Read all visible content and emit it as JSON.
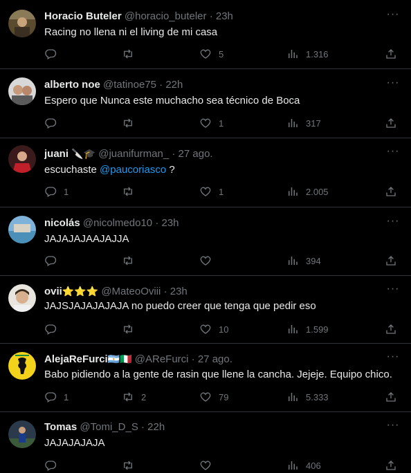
{
  "tweets": [
    {
      "name": "Horacio Buteler",
      "badges": "",
      "handle": "@horacio_buteler",
      "sep": "·",
      "time": "23h",
      "text_before": "Racing no llena ni el living de mi casa",
      "mention": "",
      "text_after": "",
      "replies": "",
      "retweets": "",
      "likes": "5",
      "views": "1.316"
    },
    {
      "name": "alberto noe",
      "badges": "",
      "handle": "@tatinoe75",
      "sep": "·",
      "time": "22h",
      "text_before": "Espero que Nunca este muchacho sea técnico de Boca",
      "mention": "",
      "text_after": "",
      "replies": "",
      "retweets": "",
      "likes": "1",
      "views": "317"
    },
    {
      "name": "juani",
      "badges": "🔪🎓",
      "handle": "@juanifurman_",
      "sep": "·",
      "time": "27 ago.",
      "text_before": "escuchaste ",
      "mention": "@paucoriasco",
      "text_after": " ?",
      "replies": "1",
      "retweets": "",
      "likes": "1",
      "views": "2.005"
    },
    {
      "name": "nicolás",
      "badges": "",
      "handle": "@nicolmedo10",
      "sep": "·",
      "time": "23h",
      "text_before": "JAJAJAJAAJAJJA",
      "mention": "",
      "text_after": "",
      "replies": "",
      "retweets": "",
      "likes": "",
      "views": "394"
    },
    {
      "name": "ovii",
      "badges": "⭐⭐⭐",
      "handle": "@MateoOviii",
      "sep": "·",
      "time": "23h",
      "text_before": "JAJSJAJAJAJAJA no puedo creer que tenga que pedir eso",
      "mention": "",
      "text_after": "",
      "replies": "",
      "retweets": "",
      "likes": "10",
      "views": "1.599"
    },
    {
      "name": "AlejaReFurci",
      "badges": "🇦🇷🇮🇹",
      "handle": "@AReFurci",
      "sep": "·",
      "time": "27 ago.",
      "text_before": "Babo pidiendo a la gente de rasin que llene la cancha. Jejeje. Equipo chico.",
      "mention": "",
      "text_after": "",
      "replies": "1",
      "retweets": "2",
      "likes": "79",
      "views": "5.333"
    },
    {
      "name": "Tomas",
      "badges": "",
      "handle": "@Tomi_D_S",
      "sep": "·",
      "time": "22h",
      "text_before": "JAJAJAJAJA",
      "mention": "",
      "text_after": "",
      "replies": "",
      "retweets": "",
      "likes": "",
      "views": "406"
    }
  ],
  "icons": {
    "more": "more-icon",
    "reply": "reply-icon",
    "retweet": "retweet-icon",
    "like": "heart-icon",
    "views": "views-icon",
    "share": "share-icon"
  },
  "colors": {
    "background": "#000000",
    "text": "#e7e9ea",
    "muted": "#71767b",
    "link": "#1d9bf0",
    "divider": "#2f3336"
  }
}
